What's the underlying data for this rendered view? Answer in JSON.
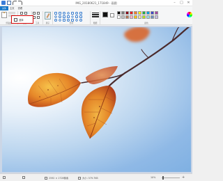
{
  "window": {
    "title": "IMG_20180621_171849 - 画图",
    "minimize_icon": "minimize-icon",
    "maximize_icon": "maximize-icon",
    "close_icon": "close-icon",
    "minimize_glyph": "–",
    "maximize_glyph": "□",
    "close_glyph": "✕"
  },
  "ribbon": {
    "file_tab": "文件",
    "tabs": [
      "主页",
      "查看"
    ],
    "groups": {
      "clipboard": "剪贴板",
      "image": "图像",
      "tools": "工具",
      "brushes": "刷子",
      "shapes": "形状",
      "size": "粗细",
      "colors": "颜色"
    },
    "select_button": "选择",
    "color1_label": "颜色1",
    "color2_label": "颜色2",
    "edit_colors_label": "编辑颜色"
  },
  "palette": [
    "#000000",
    "#7f7f7f",
    "#880015",
    "#ed1c24",
    "#ff7f27",
    "#fff200",
    "#22b14c",
    "#00a2e8",
    "#3f48cc",
    "#a349a4",
    "#ffffff",
    "#c3c3c3",
    "#b97a57",
    "#ffaec9",
    "#ffc90e",
    "#efe4b0",
    "#b5e61d",
    "#99d9ea",
    "#7092be",
    "#c8bfe7"
  ],
  "status": {
    "dimensions": "2592 × 1728像素",
    "size": "大小: 579.7KB",
    "zoom": "10%"
  },
  "zoom_level": 0.1
}
